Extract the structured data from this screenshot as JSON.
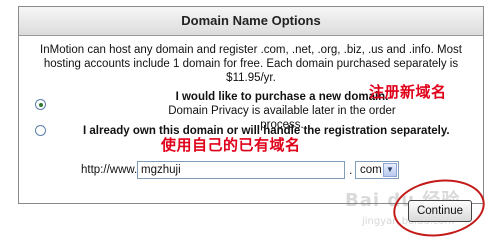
{
  "panel": {
    "title": "Domain Name Options",
    "intro": "InMotion can host any domain and register .com, .net, .org, .biz, .us and .info. Most hosting accounts include 1 domain for free. Each domain purchased separately is $11.95/yr."
  },
  "options": {
    "purchase": {
      "label": "I would like to purchase a new domain.",
      "sublabel": "Domain Privacy is available later in the order process.",
      "checked": true
    },
    "own": {
      "label": "I already own this domain or will handle the registration separately.",
      "checked": false
    }
  },
  "annotations": {
    "purchase_note": "注册新域名",
    "own_note": "使用自己的已有域名"
  },
  "domain": {
    "prefix": "http://www.",
    "value": "mgzhuji",
    "dot": ".",
    "tld": "com"
  },
  "continue_label": "Continue",
  "watermark": {
    "main": "Bai du 经验",
    "sub": "jingyan.baidu.com"
  },
  "colors": {
    "annotation": "#e0001a",
    "ring": "#c41a1a"
  }
}
